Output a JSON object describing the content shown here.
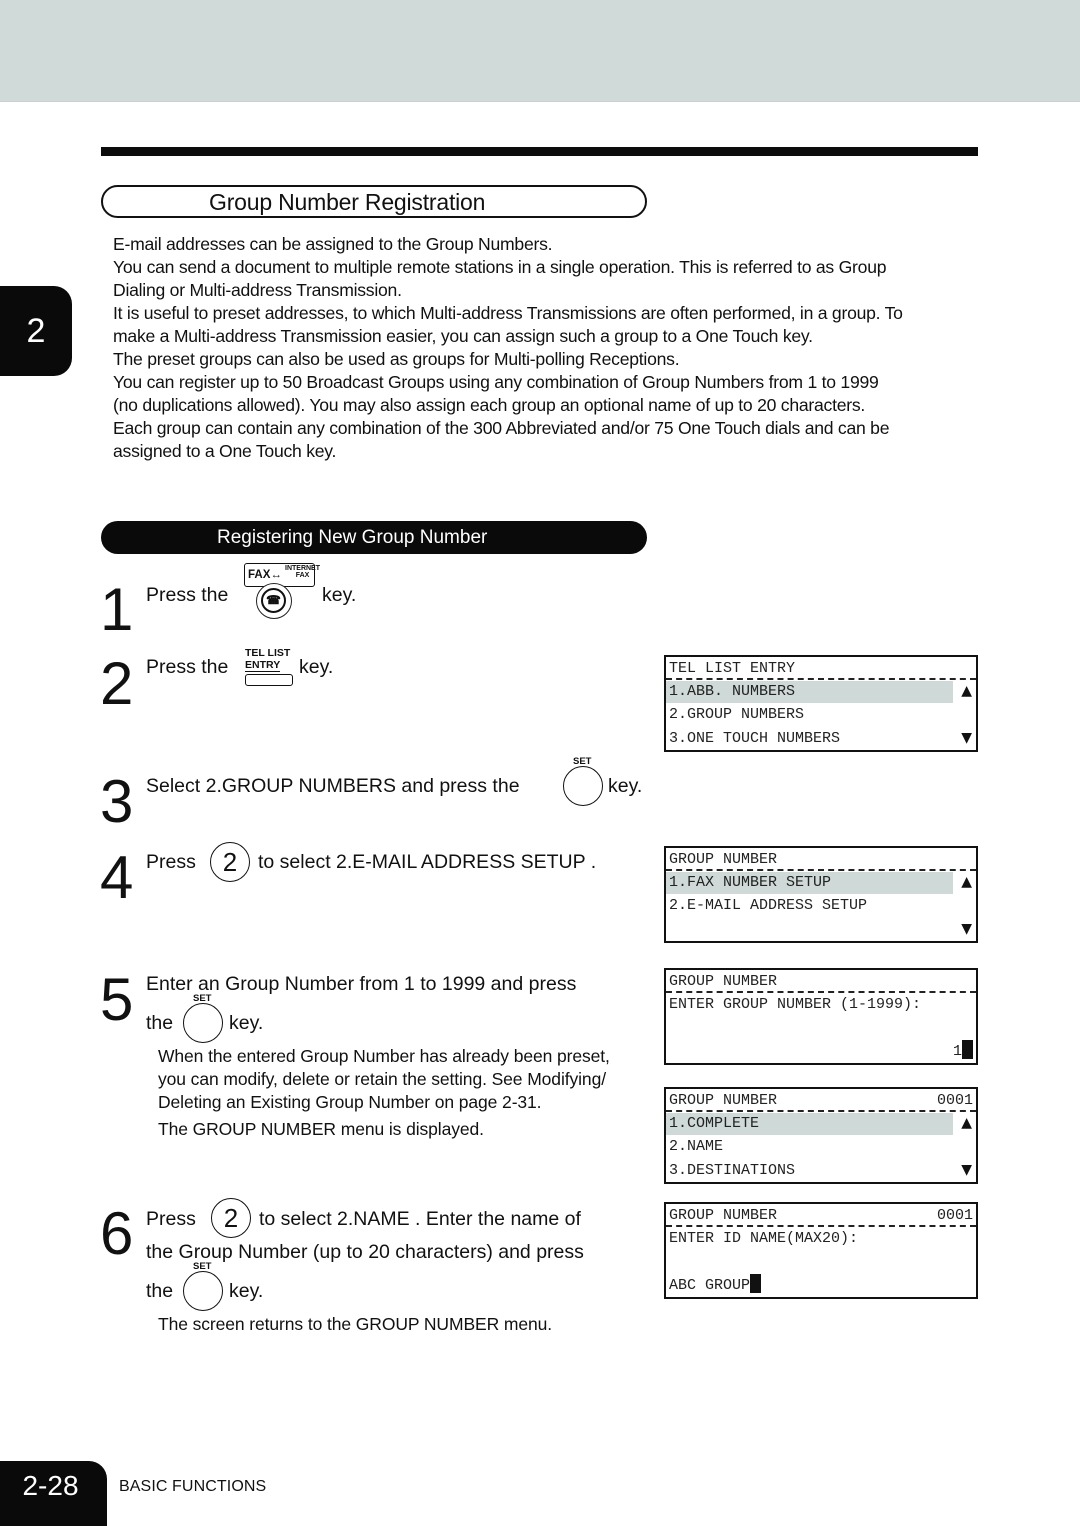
{
  "chapter": {
    "number": "2"
  },
  "section": {
    "title": "Group Number Registration"
  },
  "intro": {
    "paragraphs": [
      "E-mail addresses can be assigned to the Group Numbers.",
      "You can send a document to multiple remote stations in a single operation. This is referred to as Group\nDialing or Multi-address Transmission.",
      "It is useful to preset addresses, to which Multi-address Transmissions are often performed, in a group. To\nmake a Multi-address Transmission easier, you can assign such a group to a One Touch key.",
      "The preset groups can also be used as groups for Multi-polling Receptions.",
      "You can register up to 50 Broadcast Groups using any combination of Group Numbers from 1 to 1999\n(no duplications allowed). You may also assign each group  an optional  name of up to 20 characters.\nEach group can contain any combination of the 300 Abbreviated and/or 75 One Touch dials and can be\nassigned to a One Touch key."
    ]
  },
  "subsection": {
    "title": "Registering New Group Number"
  },
  "keys": {
    "fax_label": "FAX↔",
    "internet_fax_label_1": "INTERNET",
    "internet_fax_label_2": "FAX",
    "fax_icon_glyph": "☎",
    "tel_list_1": "TEL LIST",
    "tel_list_2": "ENTRY",
    "set_label": "SET",
    "num_2": "2"
  },
  "steps": [
    {
      "num": "1",
      "before": "Press the",
      "after": "key."
    },
    {
      "num": "2",
      "before": "Press the",
      "after": "key."
    },
    {
      "num": "3",
      "before": "Select  2.GROUP NUMBERS  and press the",
      "after": "key."
    },
    {
      "num": "4",
      "before": "Press",
      "after": "to select  2.E-MAIL ADDRESS SETUP ."
    },
    {
      "num": "5",
      "line1": "Enter an Group Number from 1 to 1999 and press",
      "before": "the",
      "after": "key.",
      "note1": "When the entered Group Number has already been preset,\nyou can modify, delete or retain the setting.  See  Modifying/\nDeleting an Existing Group Number  on page 2-31.",
      "note2": "The GROUP NUMBER menu is displayed."
    },
    {
      "num": "6",
      "before": "Press",
      "after": "to select  2.NAME .  Enter the name of",
      "line2": "the Group Number (up to 20 characters) and press",
      "before3": "the",
      "after3": "key.",
      "note": "The screen returns to the GROUP NUMBER menu."
    }
  ],
  "lcd_panels": [
    {
      "header": "TEL LIST ENTRY",
      "header_right": "",
      "rows": [
        "1.ABB. NUMBERS",
        "2.GROUP NUMBERS",
        "3.ONE TOUCH NUMBERS"
      ],
      "selected": 0
    },
    {
      "header": "GROUP NUMBER",
      "header_right": "",
      "rows": [
        "1.FAX NUMBER SETUP",
        "2.E-MAIL ADDRESS SETUP",
        ""
      ],
      "selected": 0
    },
    {
      "header": "GROUP NUMBER",
      "header_right": "",
      "rows": [
        "ENTER GROUP NUMBER (1-1999):",
        "",
        ""
      ],
      "input_value": "1"
    },
    {
      "header": "GROUP NUMBER",
      "header_right": "0001",
      "rows": [
        "1.COMPLETE",
        "2.NAME",
        "3.DESTINATIONS"
      ],
      "selected": 0
    },
    {
      "header": "GROUP NUMBER",
      "header_right": "0001",
      "rows": [
        "ENTER ID NAME(MAX20):",
        "",
        ""
      ],
      "input_value": "ABC GROUP"
    }
  ],
  "arrows": {
    "up": "▲",
    "down": "▼"
  },
  "footer": {
    "page": "2-28",
    "label": "BASIC FUNCTIONS"
  }
}
